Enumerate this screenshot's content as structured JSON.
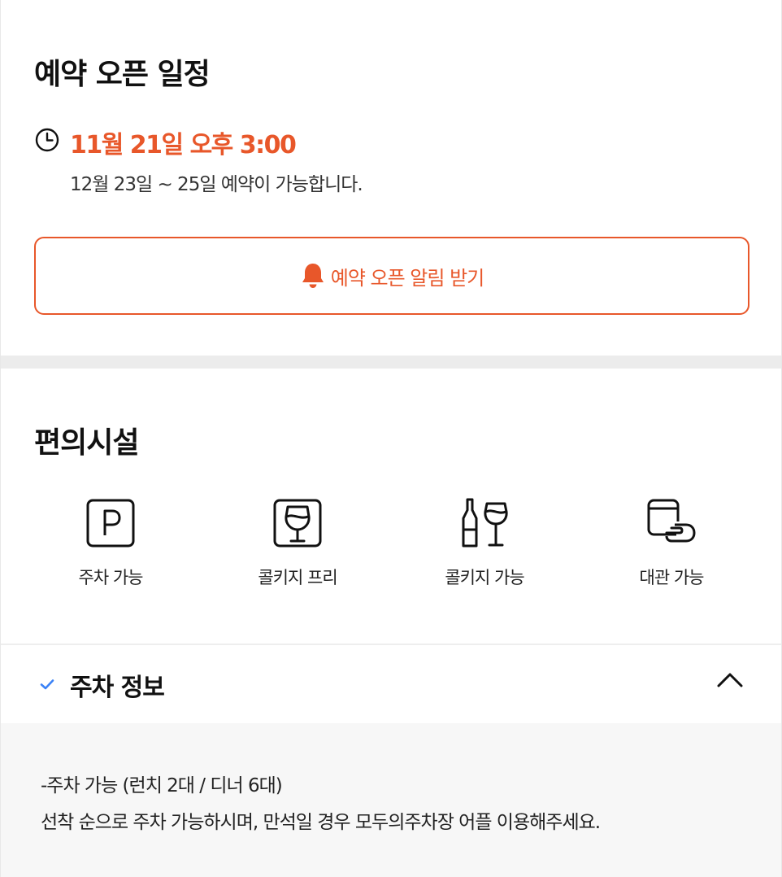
{
  "reservation": {
    "title": "예약 오픈 일정",
    "open_datetime": "11월 21일 오후 3:00",
    "description": "12월 23일 ~ 25일 예약이 가능합니다.",
    "notify_button_label": "예약 오픈 알림 받기",
    "accent_color": "#e8572a"
  },
  "amenities": {
    "title": "편의시설",
    "items": [
      {
        "icon": "parking-icon",
        "label": "주차 가능"
      },
      {
        "icon": "wine-glass-icon",
        "label": "콜키지 프리"
      },
      {
        "icon": "wine-bottle-glass-icon",
        "label": "콜키지 가능"
      },
      {
        "icon": "private-room-icon",
        "label": "대관 가능"
      }
    ]
  },
  "parking_info": {
    "title": "주차 정보",
    "expanded": true,
    "lines": [
      "-주차 가능 (런치 2대 / 디너 6대)",
      "선착 순으로 주차 가능하시며, 만석일 경우 모두의주차장 어플 이용해주세요."
    ],
    "check_color": "#3b82f6"
  }
}
